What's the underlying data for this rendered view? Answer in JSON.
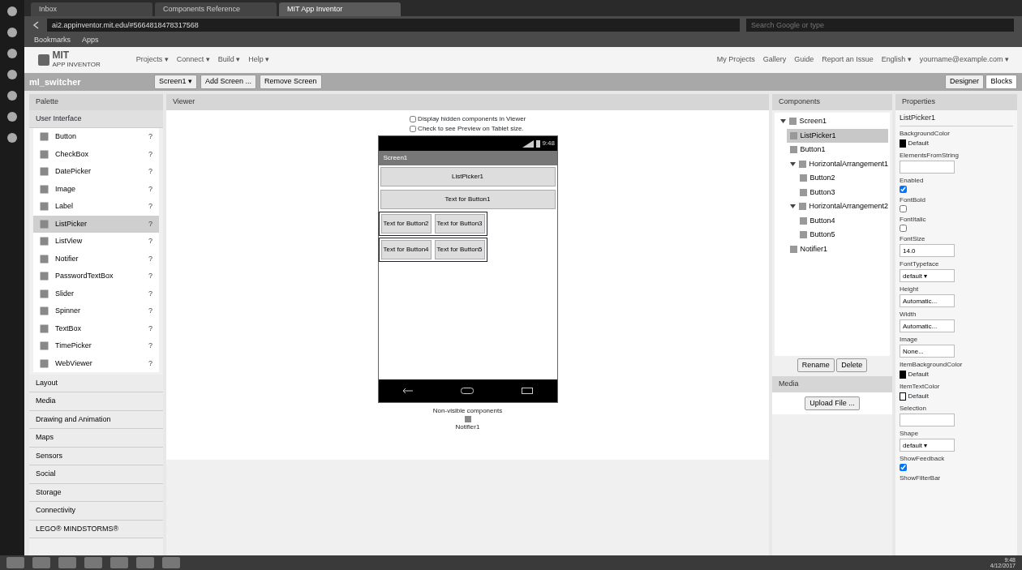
{
  "browser": {
    "tabs": [
      {
        "label": "Inbox",
        "selected": false
      },
      {
        "label": "Components Reference",
        "selected": false
      },
      {
        "label": "MIT App Inventor",
        "selected": true
      }
    ],
    "url": "ai2.appinventor.mit.edu/#5664818478317568",
    "search_placeholder": "Search Google or type",
    "bookmarks": [
      "Bookmarks",
      "Apps"
    ]
  },
  "app": {
    "logo_title": "MIT",
    "logo_subtitle": "APP INVENTOR",
    "menu": [
      "Projects ▾",
      "Connect ▾",
      "Build ▾",
      "Help ▾"
    ],
    "right_menu": [
      "My Projects",
      "Gallery",
      "Guide",
      "Report an Issue",
      "English ▾",
      "yourname@example.com ▾"
    ]
  },
  "toolbar": {
    "project": "ml_switcher",
    "buttons": [
      "Screen1 ▾",
      "Add Screen ...",
      "Remove Screen"
    ],
    "modes": [
      {
        "label": "Designer",
        "selected": false
      },
      {
        "label": "Blocks",
        "selected": true
      }
    ]
  },
  "palette": {
    "title": "Palette",
    "group": "User Interface",
    "items": [
      {
        "label": "Button",
        "selected": false
      },
      {
        "label": "CheckBox",
        "selected": false
      },
      {
        "label": "DatePicker",
        "selected": false
      },
      {
        "label": "Image",
        "selected": false
      },
      {
        "label": "Label",
        "selected": false
      },
      {
        "label": "ListPicker",
        "selected": true
      },
      {
        "label": "ListView",
        "selected": false
      },
      {
        "label": "Notifier",
        "selected": false
      },
      {
        "label": "PasswordTextBox",
        "selected": false
      },
      {
        "label": "Slider",
        "selected": false
      },
      {
        "label": "Spinner",
        "selected": false
      },
      {
        "label": "TextBox",
        "selected": false
      },
      {
        "label": "TimePicker",
        "selected": false
      },
      {
        "label": "WebViewer",
        "selected": false
      }
    ],
    "help": "?",
    "groups": [
      "Layout",
      "Media",
      "Drawing and Animation",
      "Maps",
      "Sensors",
      "Social",
      "Storage",
      "Connectivity",
      "LEGO® MINDSTORMS®"
    ]
  },
  "viewer": {
    "title": "Viewer",
    "options": [
      {
        "label": "Display hidden components in Viewer",
        "checked": false
      },
      {
        "label": "Check to see Preview on Tablet size.",
        "checked": false
      }
    ],
    "status_time": "9:48",
    "screen_title": "Screen1",
    "wide_buttons": [
      "ListPicker1",
      "Text for Button1"
    ],
    "rows": [
      [
        "Text for Button2",
        "Text for Button3"
      ],
      [
        "Text for Button4",
        "Text for Button5"
      ]
    ],
    "nonvisible_title": "Non-visible components",
    "nonvisible": [
      "Notifier1"
    ]
  },
  "components": {
    "title": "Components",
    "tree": [
      {
        "label": "Screen1",
        "selected": false,
        "expanded": true,
        "children": [
          {
            "label": "ListPicker1",
            "selected": true
          },
          {
            "label": "Button1",
            "selected": false
          },
          {
            "label": "HorizontalArrangement1",
            "selected": false,
            "expanded": true,
            "children": [
              {
                "label": "Button2",
                "selected": false
              },
              {
                "label": "Button3",
                "selected": false
              }
            ]
          },
          {
            "label": "HorizontalArrangement2",
            "selected": false,
            "expanded": true,
            "children": [
              {
                "label": "Button4",
                "selected": false
              },
              {
                "label": "Button5",
                "selected": false
              }
            ]
          },
          {
            "label": "Notifier1",
            "selected": false
          }
        ]
      }
    ],
    "buttons": [
      "Rename",
      "Delete"
    ]
  },
  "media": {
    "title": "Media",
    "button": "Upload File ..."
  },
  "properties": {
    "title": "Properties",
    "component": "ListPicker1",
    "items": [
      {
        "label": "BackgroundColor",
        "kind": "color",
        "value": "Default",
        "color": "#000000"
      },
      {
        "label": "ElementsFromString",
        "kind": "text",
        "value": ""
      },
      {
        "label": "Enabled",
        "kind": "check",
        "checked": true
      },
      {
        "label": "FontBold",
        "kind": "check",
        "checked": false
      },
      {
        "label": "FontItalic",
        "kind": "check",
        "checked": false
      },
      {
        "label": "FontSize",
        "kind": "text",
        "value": "14.0"
      },
      {
        "label": "FontTypeface",
        "kind": "select",
        "value": "default ▾"
      },
      {
        "label": "Height",
        "kind": "text",
        "value": "Automatic..."
      },
      {
        "label": "Width",
        "kind": "text",
        "value": "Automatic..."
      },
      {
        "label": "Image",
        "kind": "text",
        "value": "None..."
      },
      {
        "label": "ItemBackgroundColor",
        "kind": "color",
        "value": "Default",
        "color": "#000000"
      },
      {
        "label": "ItemTextColor",
        "kind": "color",
        "value": "Default",
        "color": "#ffffff"
      },
      {
        "label": "Selection",
        "kind": "text",
        "value": ""
      },
      {
        "label": "Shape",
        "kind": "select",
        "value": "default ▾"
      },
      {
        "label": "ShowFeedback",
        "kind": "check",
        "checked": true
      },
      {
        "label": "ShowFilterBar",
        "kind": "label"
      }
    ]
  },
  "taskbar": {
    "time": "9:48",
    "date": "4/12/2017"
  }
}
